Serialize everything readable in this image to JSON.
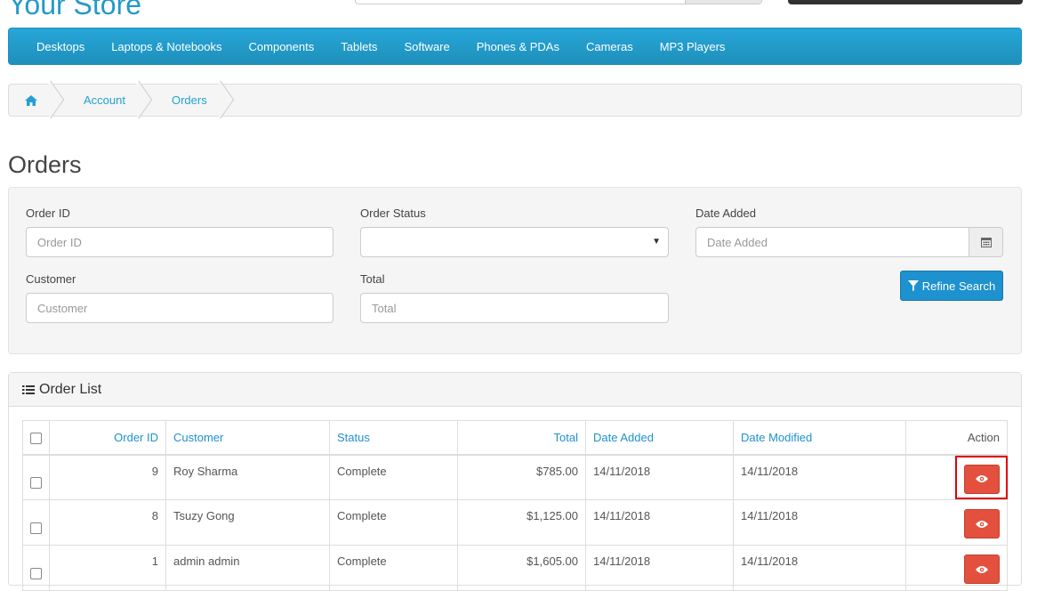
{
  "header": {
    "store_name": "Your Store"
  },
  "menu": {
    "items": [
      "Desktops",
      "Laptops & Notebooks",
      "Components",
      "Tablets",
      "Software",
      "Phones & PDAs",
      "Cameras",
      "MP3 Players"
    ]
  },
  "breadcrumb": {
    "items": [
      "Account",
      "Orders"
    ]
  },
  "page": {
    "title": "Orders"
  },
  "filter": {
    "order_id_label": "Order ID",
    "order_id_placeholder": "Order ID",
    "order_status_label": "Order Status",
    "order_status_value": "",
    "date_added_label": "Date Added",
    "date_added_placeholder": "Date Added",
    "customer_label": "Customer",
    "customer_placeholder": "Customer",
    "total_label": "Total",
    "total_placeholder": "Total",
    "refine_button": "Refine Search"
  },
  "order_list": {
    "heading": "Order List",
    "columns": [
      "Order ID",
      "Customer",
      "Status",
      "Total",
      "Date Added",
      "Date Modified",
      "Action"
    ],
    "rows": [
      {
        "order_id": "9",
        "customer": "Roy Sharma",
        "status": "Complete",
        "total": "$785.00",
        "date_added": "14/11/2018",
        "date_modified": "14/11/2018"
      },
      {
        "order_id": "8",
        "customer": "Tsuzy Gong",
        "status": "Complete",
        "total": "$1,125.00",
        "date_added": "14/11/2018",
        "date_modified": "14/11/2018"
      },
      {
        "order_id": "1",
        "customer": "admin admin",
        "status": "Complete",
        "total": "$1,605.00",
        "date_added": "14/11/2018",
        "date_modified": "14/11/2018"
      }
    ]
  },
  "colors": {
    "accent": "#229ac8",
    "menu_bg": "#1f90bb",
    "primary_button": "#1e91cf",
    "danger_button": "#e3503e",
    "highlight": "#e00000"
  }
}
